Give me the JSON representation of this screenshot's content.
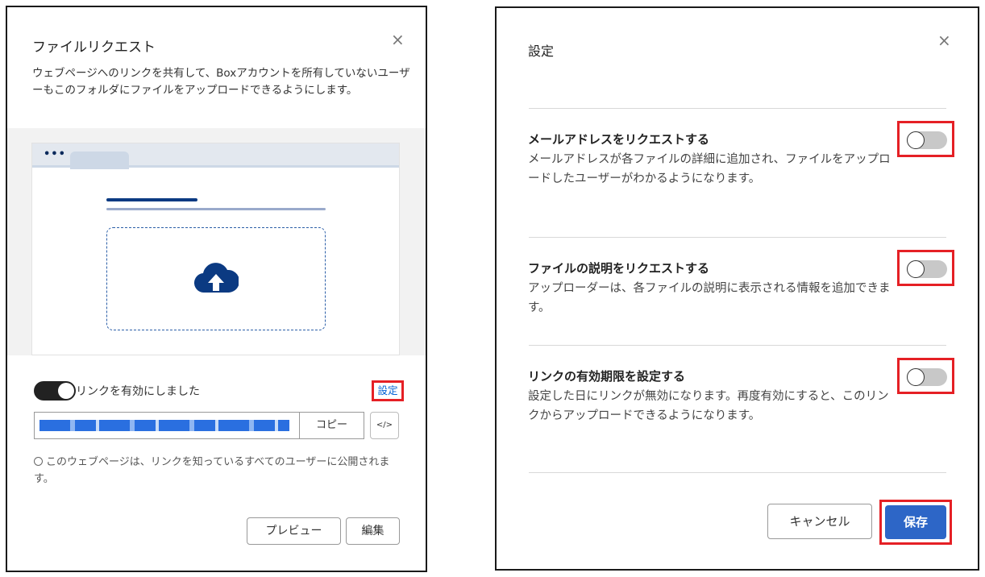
{
  "file_request_dialog": {
    "title": "ファイルリクエスト",
    "description": "ウェブページへのリンクを共有して、Boxアカウントを所有していないユーザーもこのフォルダにファイルをアップロードできるようにします。",
    "toggle_label": "リンクを有効にしました",
    "settings_link": "設定",
    "copy_button": "コピー",
    "embed_button": "</>",
    "public_note": "このウェブページは、リンクを知っているすべてのユーザーに公開されます。",
    "preview_button": "プレビュー",
    "edit_button": "編集",
    "browser_dots": "•••",
    "close_icon": "×",
    "link_enabled": true
  },
  "settings_dialog": {
    "title": "設定",
    "close_icon": "×",
    "options": [
      {
        "title": "メールアドレスをリクエストする",
        "description": "メールアドレスが各ファイルの詳細に追加され、ファイルをアップロードしたユーザーがわかるようになります。",
        "enabled": false
      },
      {
        "title": "ファイルの説明をリクエストする",
        "description": "アップローダーは、各ファイルの説明に表示される情報を追加できます。",
        "enabled": false
      },
      {
        "title": "リンクの有効期限を設定する",
        "description": "設定した日にリンクが無効になります。再度有効にすると、このリンクからアップロードできるようになります。",
        "enabled": false
      }
    ],
    "cancel_button": "キャンセル",
    "save_button": "保存"
  },
  "colors": {
    "primary_blue": "#2d66c7",
    "link_blue": "#0061d5",
    "highlight_red": "#e52025",
    "cloud_navy": "#0b3a82"
  }
}
